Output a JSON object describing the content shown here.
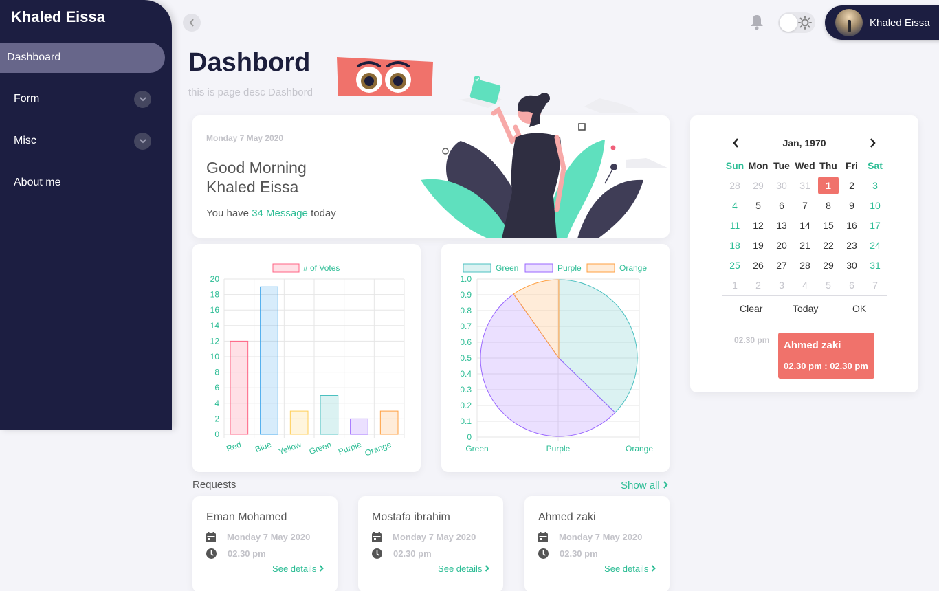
{
  "sidebar": {
    "brand": "Khaled Eissa",
    "items": [
      {
        "label": "Dashboard"
      },
      {
        "label": "Form"
      },
      {
        "label": "Misc"
      },
      {
        "label": "About me"
      }
    ]
  },
  "header": {
    "user_name": "Khaled Eissa"
  },
  "page": {
    "title": "Dashbord",
    "desc": "this is page desc Dashbord"
  },
  "welcome": {
    "date": "Monday 7 May 2020",
    "greeting_line1": "Good Morning",
    "greeting_line2": "Khaled Eissa",
    "msg_prefix": "You have",
    "msg_count": "34 Message",
    "msg_suffix": "today"
  },
  "colors": {
    "accent": "#2dbd95",
    "sidebar": "#1c1e41",
    "highlight": "#f0726b"
  },
  "chart_data": [
    {
      "type": "bar",
      "categories": [
        "Red",
        "Blue",
        "Yellow",
        "Green",
        "Purple",
        "Orange"
      ],
      "series": [
        {
          "name": "# of Votes",
          "values": [
            12,
            19,
            3,
            5,
            2,
            3
          ]
        }
      ],
      "ylim": [
        0,
        20
      ],
      "yticks": [
        0,
        2,
        4,
        6,
        8,
        10,
        12,
        14,
        16,
        18,
        20
      ],
      "colors": [
        "#ff6384",
        "#36a2eb",
        "#ffce56",
        "#4bc0c0",
        "#9966ff",
        "#ff9f40"
      ],
      "legend": "top",
      "grid": true
    },
    {
      "type": "pie",
      "categories": [
        "Green",
        "Purple",
        "Orange"
      ],
      "values": [
        3.8,
        5.4,
        1
      ],
      "colors": [
        "#4bc0c0",
        "#9966ff",
        "#ff9f40"
      ],
      "ylim": [
        0,
        1.0
      ],
      "yticks": [
        "0",
        "0.1",
        "0.2",
        "0.3",
        "0.4",
        "0.5",
        "0.6",
        "0.7",
        "0.8",
        "0.9",
        "1.0"
      ],
      "xticks": [
        "Green",
        "Purple",
        "Orange"
      ],
      "legend": "top",
      "grid": true
    }
  ],
  "calendar": {
    "month_label": "Jan, 1970",
    "days_of_week": [
      "Sun",
      "Mon",
      "Tue",
      "Wed",
      "Thu",
      "Fri",
      "Sat"
    ],
    "weeks": [
      [
        "28",
        "29",
        "30",
        "31",
        "1",
        "2",
        "3"
      ],
      [
        "4",
        "5",
        "6",
        "7",
        "8",
        "9",
        "10"
      ],
      [
        "11",
        "12",
        "13",
        "14",
        "15",
        "16",
        "17"
      ],
      [
        "18",
        "19",
        "20",
        "21",
        "22",
        "23",
        "24"
      ],
      [
        "25",
        "26",
        "27",
        "28",
        "29",
        "30",
        "31"
      ],
      [
        "1",
        "2",
        "3",
        "4",
        "5",
        "6",
        "7"
      ]
    ],
    "selected": "1",
    "actions": {
      "clear": "Clear",
      "today": "Today",
      "ok": "OK"
    },
    "event": {
      "time": "02.30 pm",
      "name": "Ahmed zaki",
      "range": "02.30 pm : 02.30 pm"
    }
  },
  "requests": {
    "title": "Requests",
    "show_all": "Show all",
    "items": [
      {
        "name": "Eman Mohamed",
        "date": "Monday 7 May 2020",
        "time": "02.30 pm",
        "link": "See details"
      },
      {
        "name": "Mostafa ibrahim",
        "date": "Monday 7 May 2020",
        "time": "02.30 pm",
        "link": "See details"
      },
      {
        "name": "Ahmed zaki",
        "date": "Monday 7 May 2020",
        "time": "02.30 pm",
        "link": "See details"
      }
    ]
  }
}
